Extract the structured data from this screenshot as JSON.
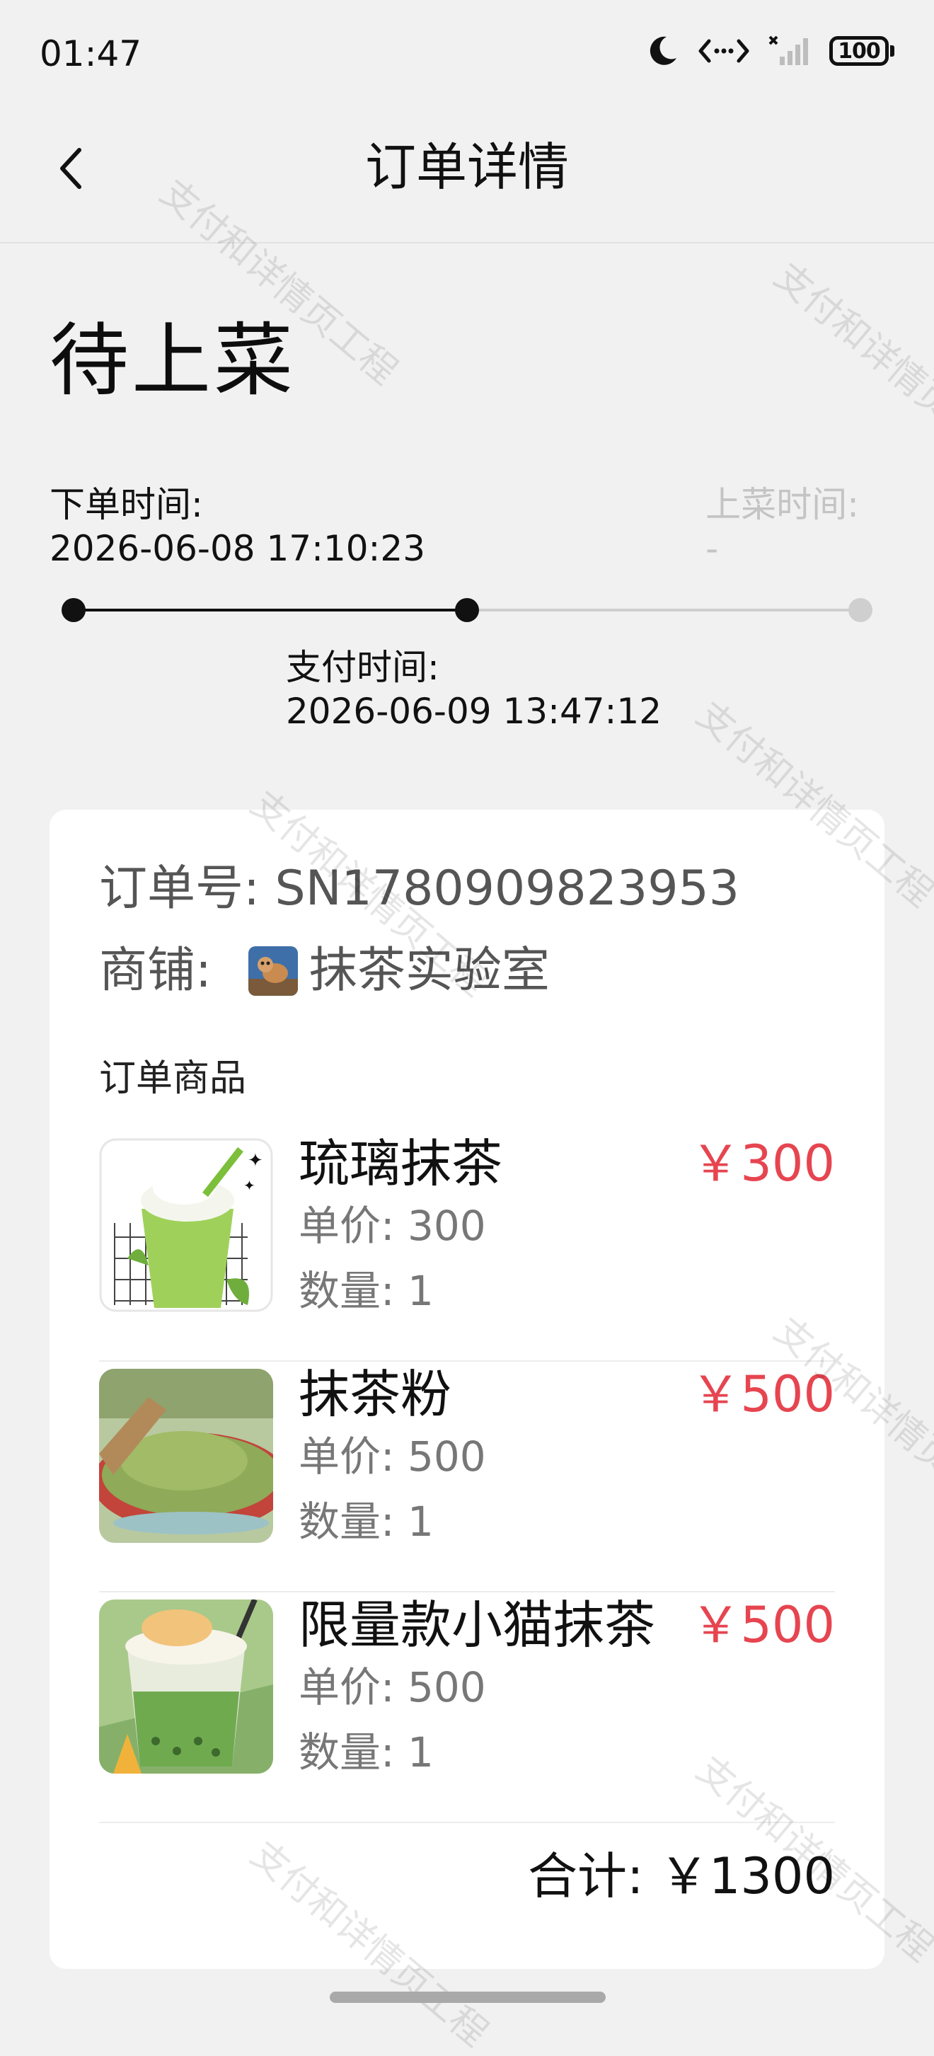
{
  "status_bar": {
    "time": "01:47",
    "battery": "100",
    "icons": [
      "moon-icon",
      "data-transfer-icon",
      "signal-icon",
      "battery-icon"
    ]
  },
  "header": {
    "title": "订单详情",
    "back_icon": "chevron-left-icon"
  },
  "order": {
    "status": "待上菜",
    "timeline": {
      "placed_label": "下单时间:",
      "placed_value": "2026-06-08 17:10:23",
      "paid_label": "支付时间:",
      "paid_value": "2026-06-09 13:47:12",
      "served_label": "上菜时间:",
      "served_value": "-",
      "progress_steps_done": 2,
      "progress_steps_total": 3
    },
    "order_no_line": "订单号: SN1780909823953",
    "shop_label": "商铺:",
    "shop_name": "抹茶实验室",
    "items_title": "订单商品",
    "items": [
      {
        "name": "琉璃抹茶",
        "price": "￥300",
        "unit_price": "单价:  300",
        "quantity": "数量:  1"
      },
      {
        "name": "抹茶粉",
        "price": "￥500",
        "unit_price": "单价:  500",
        "quantity": "数量:  1"
      },
      {
        "name": "限量款小猫抹茶",
        "price": "￥500",
        "unit_price": "单价:  500",
        "quantity": "数量:  1"
      }
    ],
    "total": "合计:   ￥1300"
  },
  "watermark_text": "支付和详情页工程",
  "colors": {
    "background": "#f1f1f1",
    "card": "#ffffff",
    "price_red": "#e64550",
    "muted": "#c4c4c4"
  }
}
